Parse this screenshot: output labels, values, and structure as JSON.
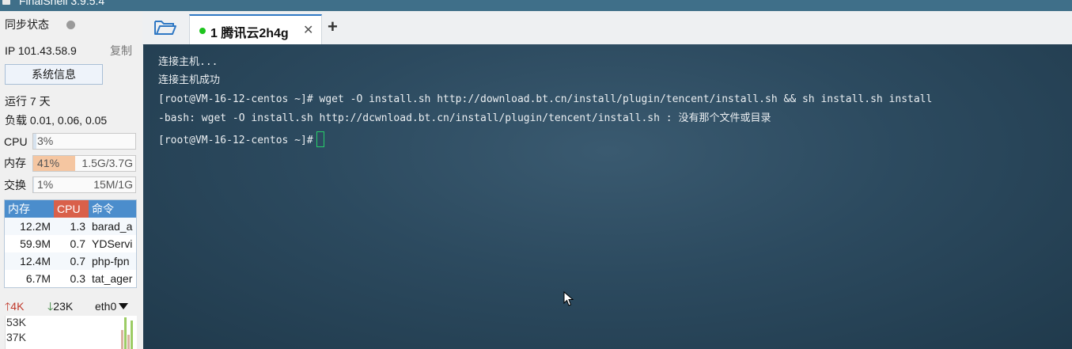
{
  "window": {
    "title": "FinalShell 3.9.5.4"
  },
  "sidebar": {
    "sync_status_label": "同步状态",
    "ip_label": "IP 101.43.58.9",
    "copy_label": "复制",
    "sysinfo_button": "系统信息",
    "uptime": "运行 7 天",
    "load": "负载 0.01, 0.06, 0.05",
    "cpu": {
      "label": "CPU",
      "percent": "3%",
      "fraction": 0.03
    },
    "mem": {
      "label": "内存",
      "percent": "41%",
      "amount": "1.5G/3.7G",
      "fraction": 0.41
    },
    "swap": {
      "label": "交换",
      "percent": "1%",
      "amount": "15M/1G",
      "fraction": 0.01
    },
    "process_table": {
      "headers": {
        "mem": "内存",
        "cpu": "CPU",
        "cmd": "命令"
      },
      "rows": [
        {
          "mem": "12.2M",
          "cpu": "1.3",
          "cmd": "barad_a"
        },
        {
          "mem": "59.9M",
          "cpu": "0.7",
          "cmd": "YDServi"
        },
        {
          "mem": "12.4M",
          "cpu": "0.7",
          "cmd": "php-fpn"
        },
        {
          "mem": "6.7M",
          "cpu": "0.3",
          "cmd": "tat_ager"
        }
      ]
    },
    "net": {
      "up": "4K",
      "down": "23K",
      "iface": "eth0"
    },
    "graph_labels": [
      "53K",
      "37K"
    ]
  },
  "tabs": [
    {
      "label": "1 腾讯云2h4g",
      "active": true,
      "status_color": "#1ec41e"
    }
  ],
  "terminal": {
    "lines": [
      "连接主机...",
      "连接主机成功",
      "[root@VM-16-12-centos ~]# wget -O install.sh http://download.bt.cn/install/plugin/tencent/install.sh && sh install.sh install",
      "-bash: wget -O install.sh http://dcwnload.bt.cn/install/plugin/tencent/install.sh : 没有那个文件或目录"
    ],
    "prompt": "[root@VM-16-12-centos ~]#"
  }
}
